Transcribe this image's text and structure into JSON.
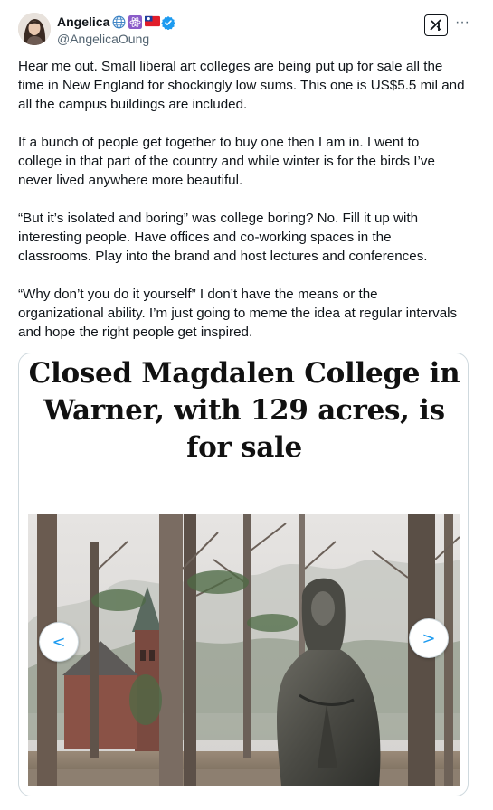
{
  "author": {
    "display_name": "Angelica",
    "handle": "@AngelicaOung",
    "badges": [
      "globe-icon",
      "atom-icon",
      "taiwan-flag-icon",
      "verified-badge-icon"
    ],
    "verified_color": "#1d9bf0"
  },
  "actions": {
    "grok_icon": "grok-icon",
    "more": "···"
  },
  "tweet": {
    "paragraphs": [
      [
        "Hear me out. Small liberal art colleges are being put up for sale all the",
        "time in New England for shockingly low sums. This one is US$5.5 mil and",
        "all the campus buildings are included."
      ],
      [
        "If a bunch of people get together to buy one then I am in. I went to",
        "college in that part of the country and while winter is for the birds I’ve",
        "never lived anywhere more beautiful."
      ],
      [
        "“But it’s isolated and boring” was college boring? No. Fill it up with",
        "interesting people. Have offices and co-working spaces in the",
        "classrooms. Play into the brand and host lectures and conferences."
      ],
      [
        "“Why don’t you do it yourself” I don’t have the means or the",
        "organizational ability. I’m just going to meme the idea at regular intervals",
        "and hope the right people get inspired."
      ]
    ]
  },
  "media": {
    "headline_lines": [
      "Closed Magdalen College in",
      "Warner, with 129 acres, is",
      "for sale"
    ],
    "prev_label": "<",
    "next_label": ">"
  }
}
